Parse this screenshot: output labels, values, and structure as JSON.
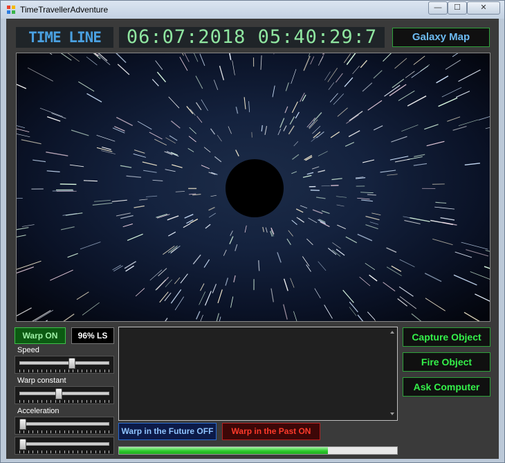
{
  "window": {
    "title": "TimeTravellerAdventure",
    "controls": {
      "minimize": "—",
      "maximize": "☐",
      "close": "✕"
    }
  },
  "timeline": {
    "label": "TIME LINE",
    "datetime": "06:07:2018 05:40:29:7"
  },
  "galaxy_map_label": "Galaxy Map",
  "warp": {
    "label": "Warp ON"
  },
  "light_speed": {
    "label": "96% LS"
  },
  "sliders": [
    {
      "label": "Speed",
      "value": 0.58
    },
    {
      "label": "Warp constant",
      "value": 0.43
    },
    {
      "label": "Acceleration",
      "value": 0.0
    },
    {
      "label": "",
      "value": 0.0
    }
  ],
  "output_text": "",
  "warp_future_label": "Warp in the Future  OFF",
  "warp_past_label": "Warp in the Past  ON",
  "progress": {
    "value": 0.75
  },
  "actions": [
    {
      "label": "Capture Object"
    },
    {
      "label": "Fire Object"
    },
    {
      "label": "Ask Computer"
    }
  ],
  "colors": {
    "accent_green": "#34f04a",
    "accent_blue": "#6cbaf0",
    "warp_on_bg": "#0c5a12",
    "past_red": "#ff3a2a"
  }
}
